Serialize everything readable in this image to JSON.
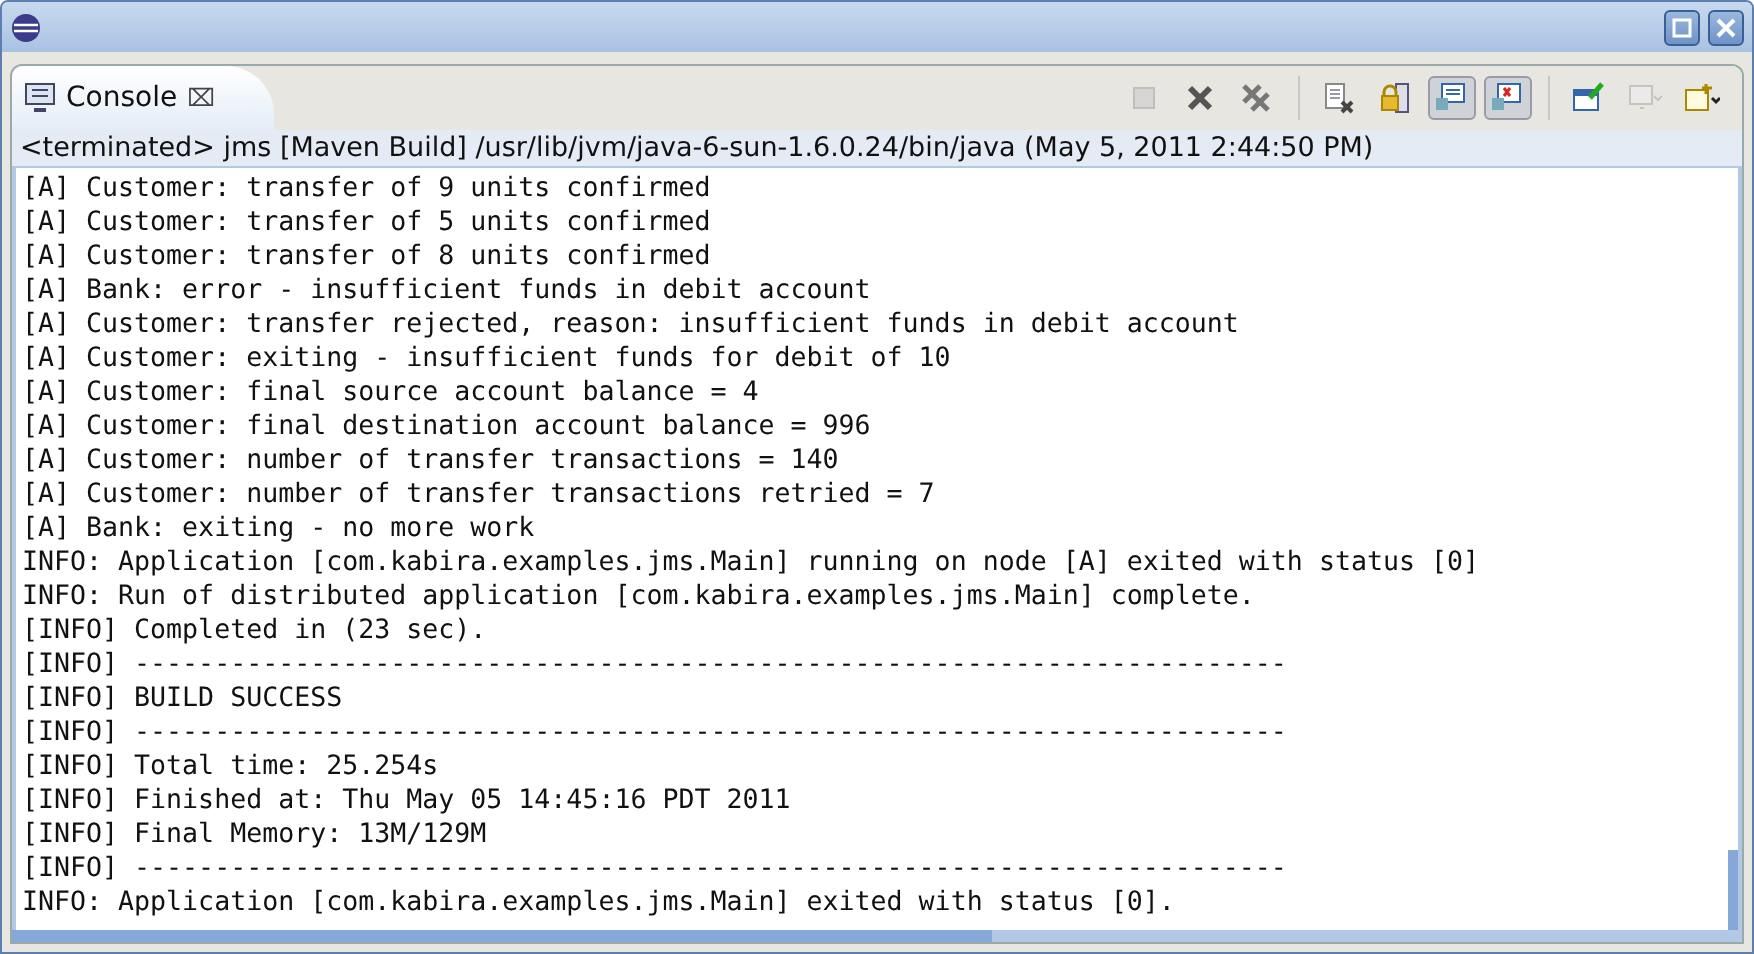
{
  "tab": {
    "label": "Console",
    "close": "⌧"
  },
  "toolbar": [
    {
      "kind": "stop",
      "disabled": true,
      "pressed": false
    },
    {
      "kind": "remove",
      "disabled": false,
      "pressed": false
    },
    {
      "kind": "remove-all",
      "disabled": false,
      "pressed": false
    },
    {
      "kind": "sep"
    },
    {
      "kind": "clear",
      "disabled": false,
      "pressed": false
    },
    {
      "kind": "lock",
      "disabled": false,
      "pressed": false
    },
    {
      "kind": "stdout",
      "disabled": false,
      "pressed": true
    },
    {
      "kind": "stderr",
      "disabled": false,
      "pressed": true
    },
    {
      "kind": "sep"
    },
    {
      "kind": "pin",
      "disabled": false,
      "pressed": false
    },
    {
      "kind": "display",
      "disabled": true,
      "pressed": false
    },
    {
      "kind": "open",
      "disabled": false,
      "pressed": false
    }
  ],
  "status": "<terminated> jms [Maven Build] /usr/lib/jvm/java-6-sun-1.6.0.24/bin/java (May 5, 2011 2:44:50 PM)",
  "lines": [
    "[A] Customer: transfer of 9 units confirmed",
    "[A] Customer: transfer of 5 units confirmed",
    "[A] Customer: transfer of 8 units confirmed",
    "[A] Bank: error - insufficient funds in debit account",
    "[A] Customer: transfer rejected, reason: insufficient funds in debit account",
    "[A] Customer: exiting - insufficient funds for debit of 10",
    "[A] Customer: final source account balance = 4",
    "[A] Customer: final destination account balance = 996",
    "[A] Customer: number of transfer transactions = 140",
    "[A] Customer: number of transfer transactions retried = 7",
    "[A] Bank: exiting - no more work",
    "INFO: Application [com.kabira.examples.jms.Main] running on node [A] exited with status [0]",
    "INFO: Run of distributed application [com.kabira.examples.jms.Main] complete.",
    "[INFO] Completed in (23 sec).",
    "[INFO] ------------------------------------------------------------------------",
    "[INFO] BUILD SUCCESS",
    "[INFO] ------------------------------------------------------------------------",
    "[INFO] Total time: 25.254s",
    "[INFO] Finished at: Thu May 05 14:45:16 PDT 2011",
    "[INFO] Final Memory: 13M/129M",
    "[INFO] ------------------------------------------------------------------------",
    "INFO: Application [com.kabira.examples.jms.Main] exited with status [0]."
  ]
}
